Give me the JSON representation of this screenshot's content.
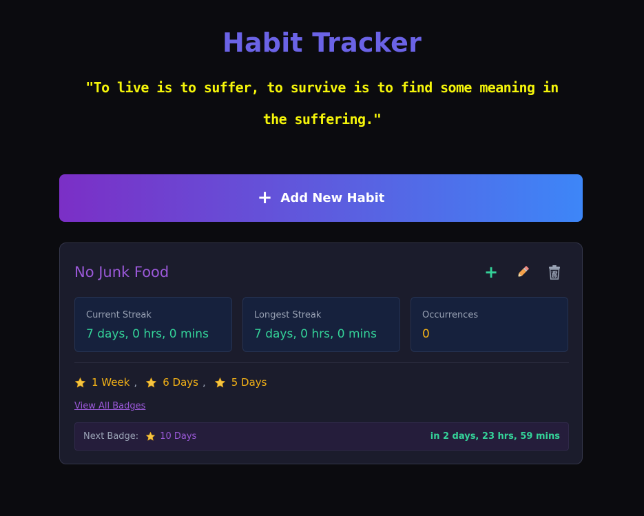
{
  "header": {
    "title": "Habit Tracker",
    "quote": "\"To live is to suffer, to survive is to find some meaning in the suffering.\""
  },
  "add_button": {
    "icon": "plus-icon",
    "label": "Add New Habit"
  },
  "habit": {
    "name": "No Junk Food",
    "actions": {
      "add_icon": "plus-icon",
      "edit_icon": "pencil-icon",
      "delete_icon": "trash-icon"
    },
    "stats": [
      {
        "label": "Current Streak",
        "value": "7 days, 0 hrs, 0 mins"
      },
      {
        "label": "Longest Streak",
        "value": "7 days, 0 hrs, 0 mins"
      },
      {
        "label": "Occurrences",
        "value": "0"
      }
    ],
    "badges": [
      "1 Week",
      "6 Days",
      "5 Days"
    ],
    "badge_separator": ",",
    "view_all": "View All Badges",
    "next_badge": {
      "label": "Next Badge:",
      "name": "10 Days",
      "time": "in 2 days, 23 hrs, 59 mins"
    }
  },
  "colors": {
    "title": "#6b63e6",
    "quote": "#f5f50a",
    "accent_purple": "#9b59d9",
    "accent_green": "#34d399",
    "badge_gold": "#f5b316",
    "gradient_start": "#7b2fc6",
    "gradient_end": "#3d86f8"
  }
}
